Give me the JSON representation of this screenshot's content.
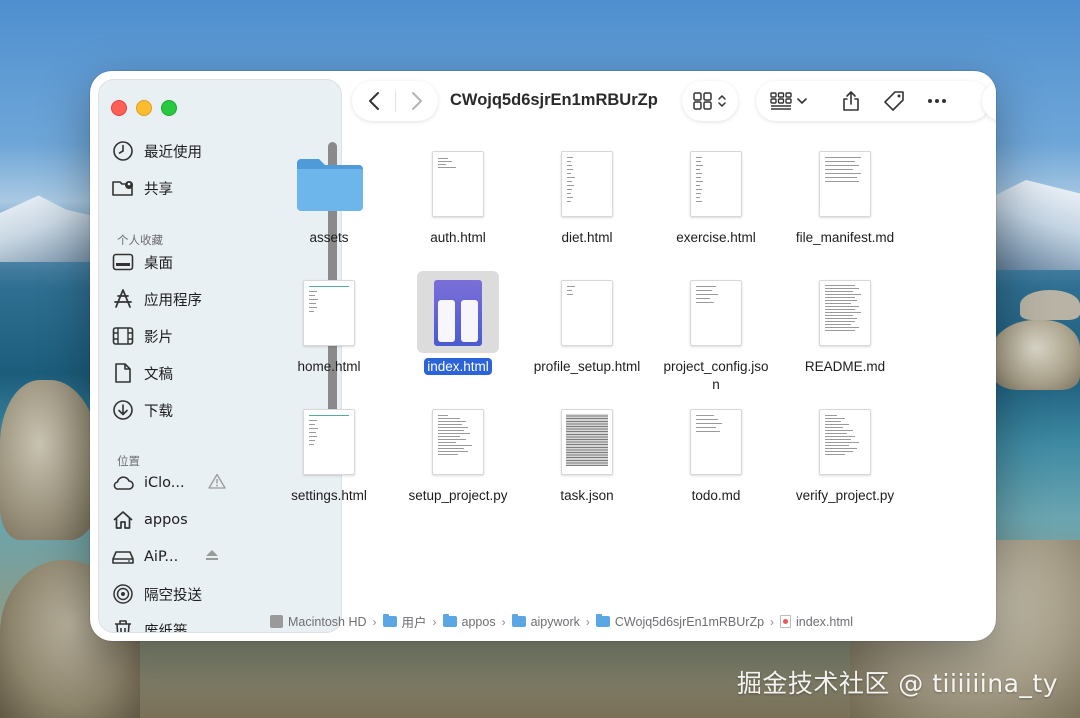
{
  "window": {
    "title": "CWojq5d6sjrEn1mRBUrZp"
  },
  "sidebar": {
    "recents_label": "最近使用",
    "shared_label": "共享",
    "favorites_section": "个人收藏",
    "favorites": [
      {
        "label": "桌面",
        "icon": "desktop-icon"
      },
      {
        "label": "应用程序",
        "icon": "applications-icon"
      },
      {
        "label": "影片",
        "icon": "movies-icon"
      },
      {
        "label": "文稿",
        "icon": "document-icon"
      },
      {
        "label": "下载",
        "icon": "download-icon"
      }
    ],
    "locations_section": "位置",
    "locations": [
      {
        "label": "iClo...",
        "icon": "icloud-icon"
      },
      {
        "label": "appos",
        "icon": "home-icon"
      },
      {
        "label": "AiP...",
        "icon": "drive-icon"
      },
      {
        "label": "隔空投送",
        "icon": "airdrop-icon"
      },
      {
        "label": "废纸篓",
        "icon": "trash-icon"
      }
    ]
  },
  "files": [
    {
      "name": "assets",
      "kind": "folder"
    },
    {
      "name": "auth.html",
      "kind": "doc"
    },
    {
      "name": "diet.html",
      "kind": "doc"
    },
    {
      "name": "exercise.html",
      "kind": "doc"
    },
    {
      "name": "file_manifest.md",
      "kind": "doc"
    },
    {
      "name": "home.html",
      "kind": "doc"
    },
    {
      "name": "index.html",
      "kind": "selected"
    },
    {
      "name": "profile_setup.html",
      "kind": "doc"
    },
    {
      "name": "project_config.json",
      "line1": "project_config.jso",
      "line2": "n",
      "kind": "doc"
    },
    {
      "name": "README.md",
      "kind": "doc"
    },
    {
      "name": "settings.html",
      "kind": "doc"
    },
    {
      "name": "setup_project.py",
      "kind": "doc"
    },
    {
      "name": "task.json",
      "kind": "dense"
    },
    {
      "name": "todo.md",
      "kind": "doc"
    },
    {
      "name": "verify_project.py",
      "kind": "doc"
    }
  ],
  "pathbar": {
    "segments": [
      "Macintosh HD",
      "用户",
      "appos",
      "aipywork",
      "CWojq5d6sjrEn1mRBUrZp",
      "index.html"
    ]
  },
  "watermark": "掘金技术社区 @ tiiiiiina_ty",
  "colors": {
    "selection": "#2b63d9",
    "folder": "#5aa7e3",
    "sidebar_bg": "#e9f0f3"
  }
}
